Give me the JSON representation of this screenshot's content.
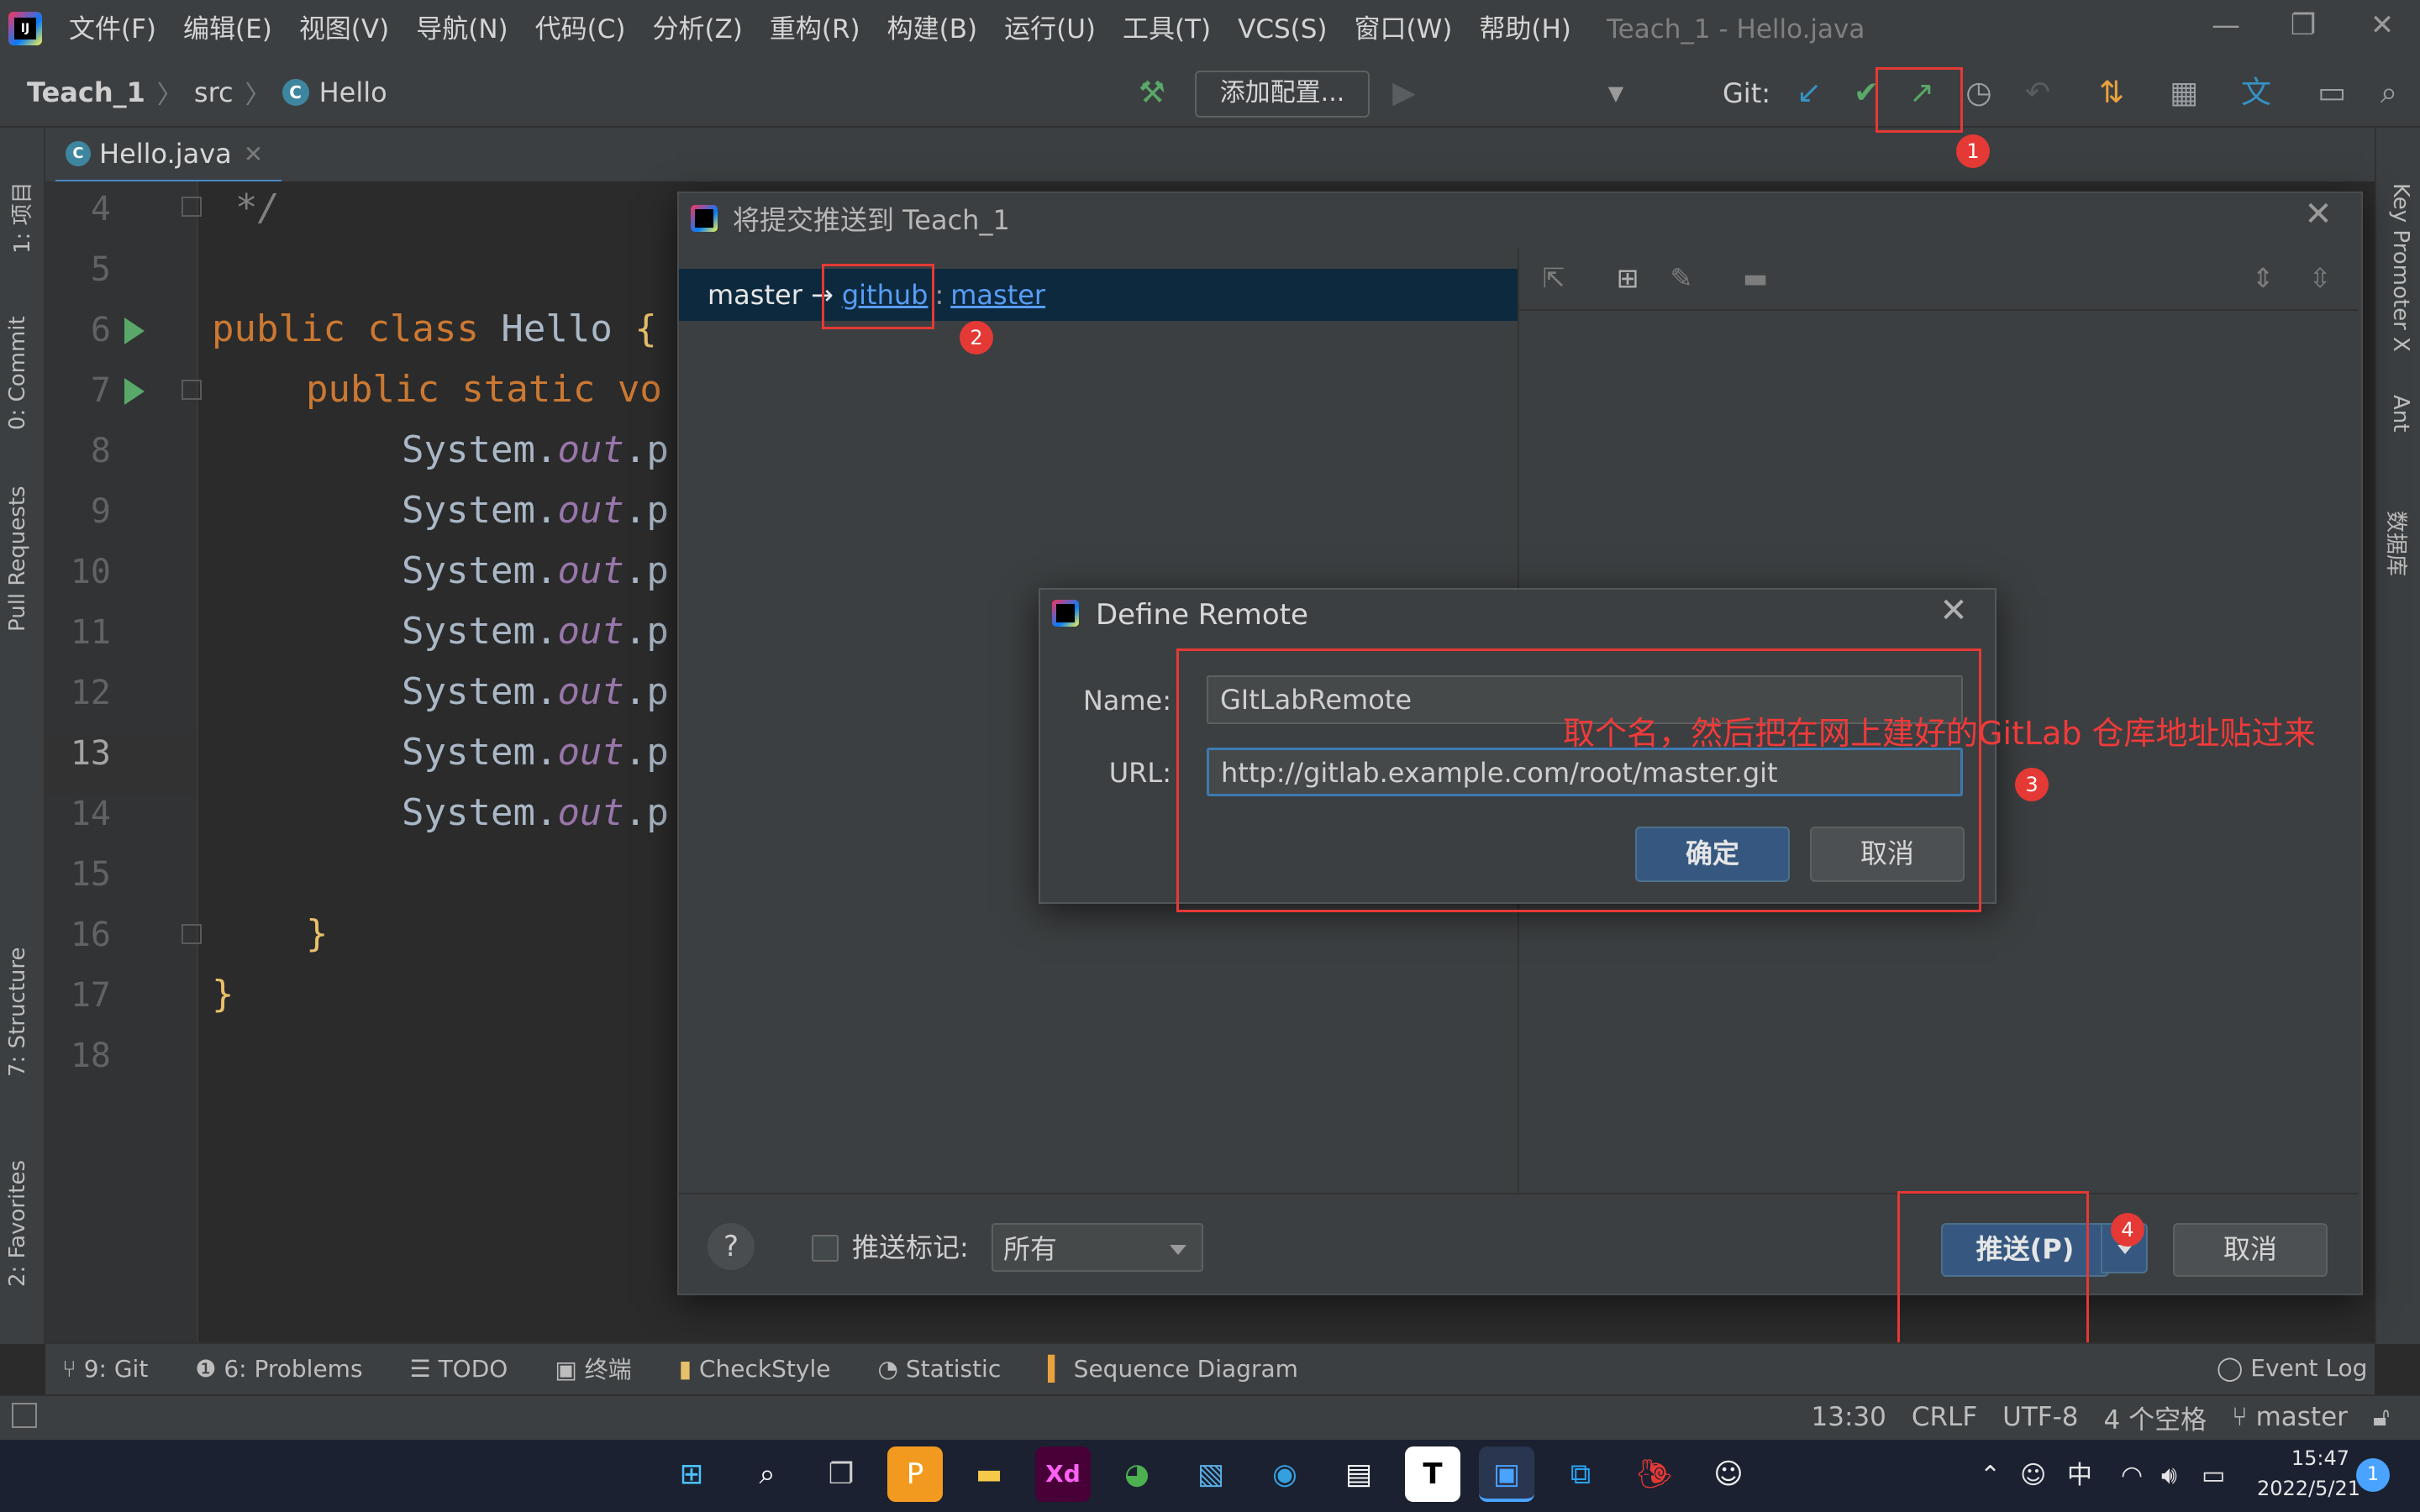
{
  "menu": {
    "items": [
      "文件(F)",
      "编辑(E)",
      "视图(V)",
      "导航(N)",
      "代码(C)",
      "分析(Z)",
      "重构(R)",
      "构建(B)",
      "运行(U)",
      "工具(T)",
      "VCS(S)",
      "窗口(W)",
      "帮助(H)"
    ],
    "window_title": "Teach_1 - Hello.java"
  },
  "nav": {
    "project": "Teach_1",
    "folder": "src",
    "file": "Hello",
    "add_config": "添加配置...",
    "git_label": "Git:"
  },
  "left_tabs": [
    "1: 项目",
    "0: Commit",
    "Pull Requests",
    "7: Structure",
    "2: Favorites"
  ],
  "right_tabs": [
    "Key Promoter X",
    "Ant",
    "数据库"
  ],
  "editor": {
    "tab": "Hello.java",
    "line_numbers": [
      "4",
      "5",
      "6",
      "7",
      "8",
      "9",
      "10",
      "11",
      "12",
      "13",
      "14",
      "15",
      "16",
      "17",
      "18"
    ],
    "current_line": "13",
    "code": {
      "l4": "*/",
      "l6_kw": "public class ",
      "l6_name": "Hello ",
      "l6_br": "{",
      "l7": "public static vo",
      "sys_a": "System.",
      "sys_out": "out",
      "sys_b": ".p",
      "l16": "}",
      "l17": "}"
    }
  },
  "push_dialog": {
    "title": "将提交推送到 Teach_1",
    "branch_local": "master →",
    "remote": "github",
    "colon": ":",
    "remote_branch": "master",
    "push_tags_label": "推送标记:",
    "tags_value": "所有",
    "push_button": "推送(P)",
    "cancel_button": "取消",
    "help": "?"
  },
  "define_remote": {
    "title": "Define Remote",
    "name_label": "Name:",
    "name_value": "GItLabRemote",
    "url_label": "URL:",
    "url_value": "http://gitlab.example.com/root/master.git",
    "ok_button": "确定",
    "cancel_button": "取消"
  },
  "annotations": {
    "note": "取个名，然后把在网上建好的GitLab 仓库地址贴过来",
    "badges": [
      "1",
      "2",
      "3",
      "4"
    ],
    "color": "#e53935"
  },
  "tool_windows": [
    "9: Git",
    "6: Problems",
    "TODO",
    "终端",
    "CheckStyle",
    "Statistic",
    "Sequence Diagram"
  ],
  "event_log": "Event Log",
  "status": {
    "position": "13:30",
    "line_sep": "CRLF",
    "encoding": "UTF-8",
    "indent": "4 个空格",
    "branch": "master"
  },
  "taskbar": {
    "time": "15:47",
    "date": "2022/5/21",
    "ime": "中",
    "notifications": "1"
  },
  "colors": {
    "accent": "#365880",
    "link": "#589df6",
    "background": "#2b2b2b"
  }
}
